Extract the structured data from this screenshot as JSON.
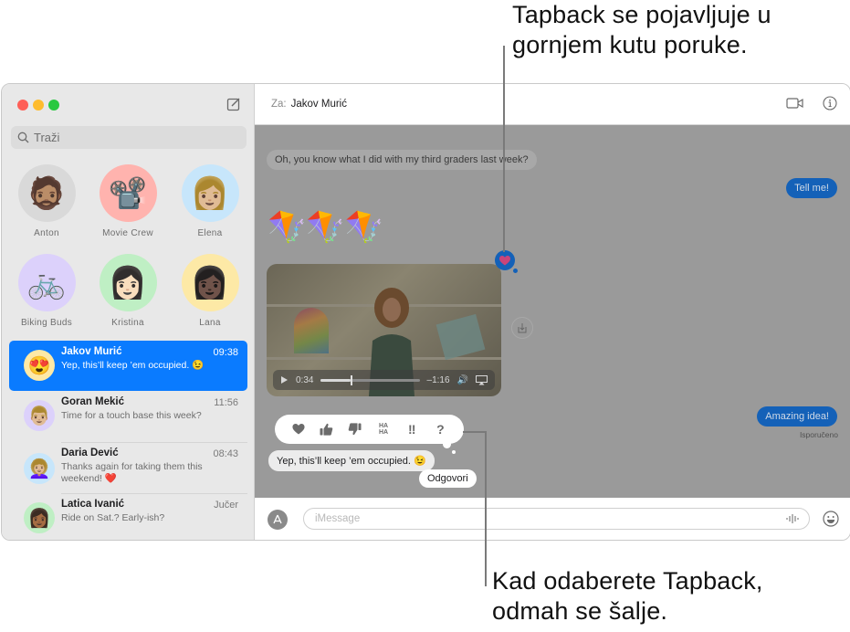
{
  "callouts": {
    "top": [
      "Tapback se pojavljuje u",
      "gornjem kutu poruke."
    ],
    "bottom": [
      "Kad odaberete Tapback,",
      "odmah se šalje."
    ]
  },
  "sidebar": {
    "search_placeholder": "Traži",
    "pinned": [
      {
        "name": "Anton",
        "icon": "memoji-bearded-man",
        "bg": "#d9d9d9",
        "glyph": "🧔🏽"
      },
      {
        "name": "Movie Crew",
        "icon": "film-projector-icon",
        "bg": "#ffb3ae",
        "glyph": "📽️"
      },
      {
        "name": "Elena",
        "icon": "memoji-woman-hat",
        "bg": "#c7e6fb",
        "glyph": "👩🏼"
      },
      {
        "name": "Biking Buds",
        "icon": "bicycle-icon",
        "bg": "#dcd1fb",
        "glyph": "🚲"
      },
      {
        "name": "Kristina",
        "icon": "memoji-woman-brown-hair",
        "bg": "#bfefc4",
        "glyph": "👩🏻"
      },
      {
        "name": "Lana",
        "icon": "memoji-woman-dark",
        "bg": "#fde9a6",
        "glyph": "👩🏿"
      }
    ],
    "conversations": [
      {
        "name": "Jakov Murić",
        "time": "09:38",
        "preview": "Yep, this’ll keep ’em occupied. 😉",
        "avatar_bg": "#fde9a6",
        "glyph": "😍",
        "selected": true
      },
      {
        "name": "Goran Mekić",
        "time": "11:56",
        "preview": "Time for a touch base this week?",
        "avatar_bg": "#dcd1fb",
        "glyph": "👨🏼",
        "selected": false
      },
      {
        "name": "Daria Dević",
        "time": "08:43",
        "preview": "Thanks again for taking them this weekend! ❤️",
        "avatar_bg": "#c7e6fb",
        "glyph": "👩🏼‍🦱",
        "selected": false
      },
      {
        "name": "Latica Ivanić",
        "time": "Jučer",
        "preview": "Ride on Sat.? Early-ish?",
        "avatar_bg": "#bfefc4",
        "glyph": "👩🏾",
        "selected": false
      }
    ]
  },
  "header": {
    "to_label": "Za:",
    "recipient": "Jakov Murić"
  },
  "chat": {
    "messages": {
      "m1": "Oh, you know what I did with my third graders last week?",
      "m2": "Tell me!",
      "kites": "🪁🪁🪁",
      "m4": "Amazing idea!",
      "m5": "Yep, this’ll keep ’em occupied. 😉"
    },
    "video": {
      "elapsed": "0:34",
      "remaining": "–1:16",
      "progress": 0.3
    },
    "delivered_status": "Isporučeno",
    "tapback_options": [
      "heart",
      "thumbs-up",
      "thumbs-down",
      "haha",
      "exclamation",
      "question"
    ],
    "tapback_selected": "heart",
    "reply_label": "Odgovori"
  },
  "input": {
    "placeholder": "iMessage"
  },
  "colors": {
    "accent": "#0a7bff",
    "sent_bubble": "#1461b8",
    "overlay": "#9a9a9a"
  }
}
